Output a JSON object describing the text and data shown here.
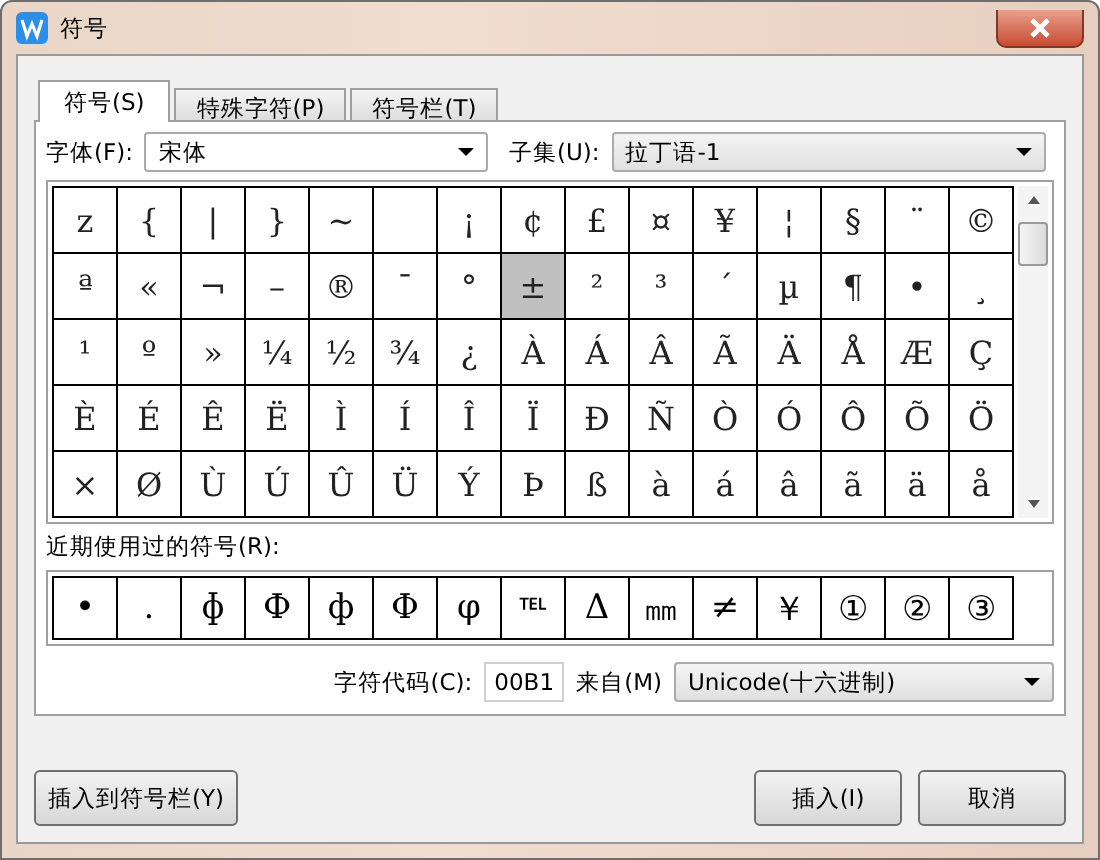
{
  "window": {
    "title": "符号"
  },
  "tabs": [
    {
      "label": "符号(S)",
      "selected": true
    },
    {
      "label": "特殊字符(P)",
      "selected": false
    },
    {
      "label": "符号栏(T)",
      "selected": false
    }
  ],
  "font": {
    "label": "字体(F):",
    "value": "宋体"
  },
  "subset": {
    "label": "子集(U):",
    "value": "拉丁语-1"
  },
  "grid": [
    {
      "char": "z",
      "selected": false
    },
    {
      "char": "{",
      "selected": false
    },
    {
      "char": "|",
      "selected": false
    },
    {
      "char": "}",
      "selected": false
    },
    {
      "char": "~",
      "selected": false
    },
    {
      "selected": false
    },
    {
      "char": "¡",
      "selected": false
    },
    {
      "char": "¢",
      "selected": false
    },
    {
      "char": "£",
      "selected": false
    },
    {
      "char": "¤",
      "selected": false
    },
    {
      "char": "¥",
      "selected": false
    },
    {
      "char": "¦",
      "selected": false
    },
    {
      "char": "§",
      "selected": false
    },
    {
      "char": "¨",
      "selected": false
    },
    {
      "char": "©",
      "selected": false
    },
    {
      "char": "ª",
      "selected": false
    },
    {
      "char": "«",
      "selected": false
    },
    {
      "char": "¬",
      "selected": false
    },
    {
      "char": "–",
      "selected": false
    },
    {
      "char": "®",
      "selected": false
    },
    {
      "char": "¯",
      "selected": false
    },
    {
      "char": "°",
      "selected": false
    },
    {
      "char": "±",
      "selected": true
    },
    {
      "char": "²",
      "selected": false
    },
    {
      "char": "³",
      "selected": false
    },
    {
      "char": "´",
      "selected": false
    },
    {
      "char": "µ",
      "selected": false
    },
    {
      "char": "¶",
      "selected": false
    },
    {
      "char": "•",
      "selected": false
    },
    {
      "char": "¸",
      "selected": false
    },
    {
      "char": "¹",
      "selected": false
    },
    {
      "char": "º",
      "selected": false
    },
    {
      "char": "»",
      "selected": false
    },
    {
      "char": "¼",
      "selected": false
    },
    {
      "char": "½",
      "selected": false
    },
    {
      "char": "¾",
      "selected": false
    },
    {
      "char": "¿",
      "selected": false
    },
    {
      "char": "À",
      "selected": false
    },
    {
      "char": "Á",
      "selected": false
    },
    {
      "char": "Â",
      "selected": false
    },
    {
      "char": "Ã",
      "selected": false
    },
    {
      "char": "Ä",
      "selected": false
    },
    {
      "char": "Å",
      "selected": false
    },
    {
      "char": "Æ",
      "selected": false
    },
    {
      "char": "Ç",
      "selected": false
    },
    {
      "char": "È",
      "selected": false
    },
    {
      "char": "É",
      "selected": false
    },
    {
      "char": "Ê",
      "selected": false
    },
    {
      "char": "Ë",
      "selected": false
    },
    {
      "char": "Ì",
      "selected": false
    },
    {
      "char": "Í",
      "selected": false
    },
    {
      "char": "Î",
      "selected": false
    },
    {
      "char": "Ï",
      "selected": false
    },
    {
      "char": "Ð",
      "selected": false
    },
    {
      "char": "Ñ",
      "selected": false
    },
    {
      "char": "Ò",
      "selected": false
    },
    {
      "char": "Ó",
      "selected": false
    },
    {
      "char": "Ô",
      "selected": false
    },
    {
      "char": "Õ",
      "selected": false
    },
    {
      "char": "Ö",
      "selected": false
    },
    {
      "char": "×",
      "selected": false
    },
    {
      "char": "Ø",
      "selected": false
    },
    {
      "char": "Ù",
      "selected": false
    },
    {
      "char": "Ú",
      "selected": false
    },
    {
      "char": "Û",
      "selected": false
    },
    {
      "char": "Ü",
      "selected": false
    },
    {
      "char": "Ý",
      "selected": false
    },
    {
      "char": "Þ",
      "selected": false
    },
    {
      "char": "ß",
      "selected": false
    },
    {
      "char": "à",
      "selected": false
    },
    {
      "char": "á",
      "selected": false
    },
    {
      "char": "â",
      "selected": false
    },
    {
      "char": "ã",
      "selected": false
    },
    {
      "char": "ä",
      "selected": false
    },
    {
      "char": "å",
      "selected": false
    }
  ],
  "recent": {
    "label": "近期使用过的符号(R):",
    "chars": [
      "•",
      ".",
      "ɸ",
      "Ф",
      "ф",
      "Φ",
      "φ",
      "℡",
      "Δ",
      "㎜",
      "≠",
      "￥",
      "①",
      "②",
      "③"
    ]
  },
  "code": {
    "label": "字符代码(C):",
    "value": "00B1"
  },
  "from": {
    "label": "来自(M)",
    "value": "Unicode(十六进制)"
  },
  "buttons": [
    "插入到符号栏(Y)",
    "插入(I)",
    "取消"
  ]
}
